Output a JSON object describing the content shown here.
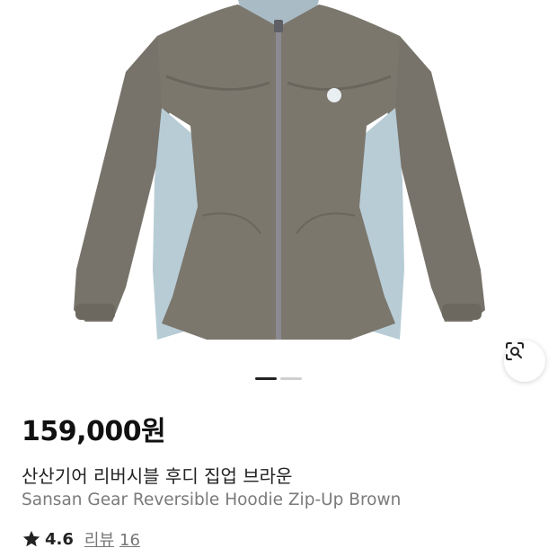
{
  "product": {
    "image_alt": "hoodie-product-image",
    "price": "159,000원",
    "title_ko": "산산기어 리버시블 후디 집업 브라운",
    "title_en": "Sansan Gear Reversible Hoodie Zip-Up Brown",
    "rating": "4.6",
    "review_label": "리뷰",
    "review_count": "16"
  },
  "gallery": {
    "current_index": 1,
    "total": 2
  },
  "icons": {
    "lens": "visual-search-icon",
    "star": "star-icon"
  },
  "colors": {
    "jacket_body": "#7b776d",
    "jacket_panel": "#b8ccd6",
    "zipper": "#8a8a90"
  }
}
